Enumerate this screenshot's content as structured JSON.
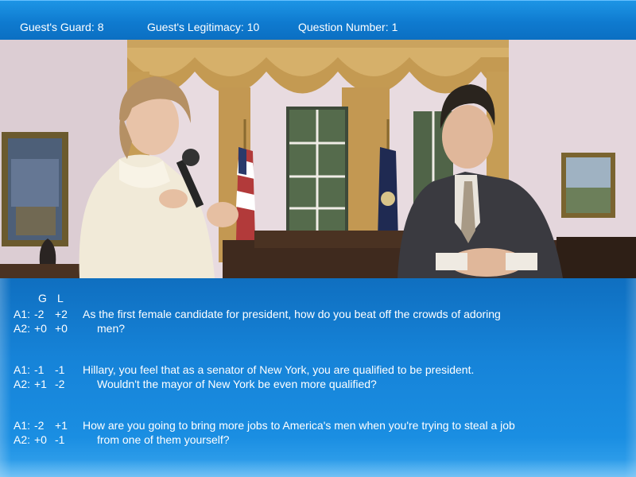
{
  "status": {
    "guard_label": "Guest's Guard:",
    "guard_value": "8",
    "legitimacy_label": "Guest's Legitimacy:",
    "legitimacy_value": "10",
    "question_label": "Question Number:",
    "question_value": "1"
  },
  "columns": {
    "g": "G",
    "l": "L"
  },
  "questions": [
    {
      "a1": {
        "label": "A1:",
        "g": "-2",
        "l": "+2"
      },
      "a2": {
        "label": "A2:",
        "g": "+0",
        "l": "+0"
      },
      "line1": "As the first female candidate for president, how do you beat off the crowds of adoring",
      "line2": "men?"
    },
    {
      "a1": {
        "label": "A1:",
        "g": "-1",
        "l": "-1"
      },
      "a2": {
        "label": "A2:",
        "g": "+1",
        "l": "-2"
      },
      "line1": "Hillary, you feel that as a senator of New York, you are qualified to be president.",
      "line2": "Wouldn't the mayor of New York be even more qualified?"
    },
    {
      "a1": {
        "label": "A1:",
        "g": "-2",
        "l": "+1"
      },
      "a2": {
        "label": "A2:",
        "g": "+0",
        "l": "-1"
      },
      "line1": "How are you going to bring more jobs to America's men when you're trying to steal a job",
      "line2": "from one of them yourself?"
    }
  ],
  "colors": {
    "bar_blue": "#0f7bd0",
    "panel_blue": "#1683d8",
    "text": "#ffffff"
  }
}
